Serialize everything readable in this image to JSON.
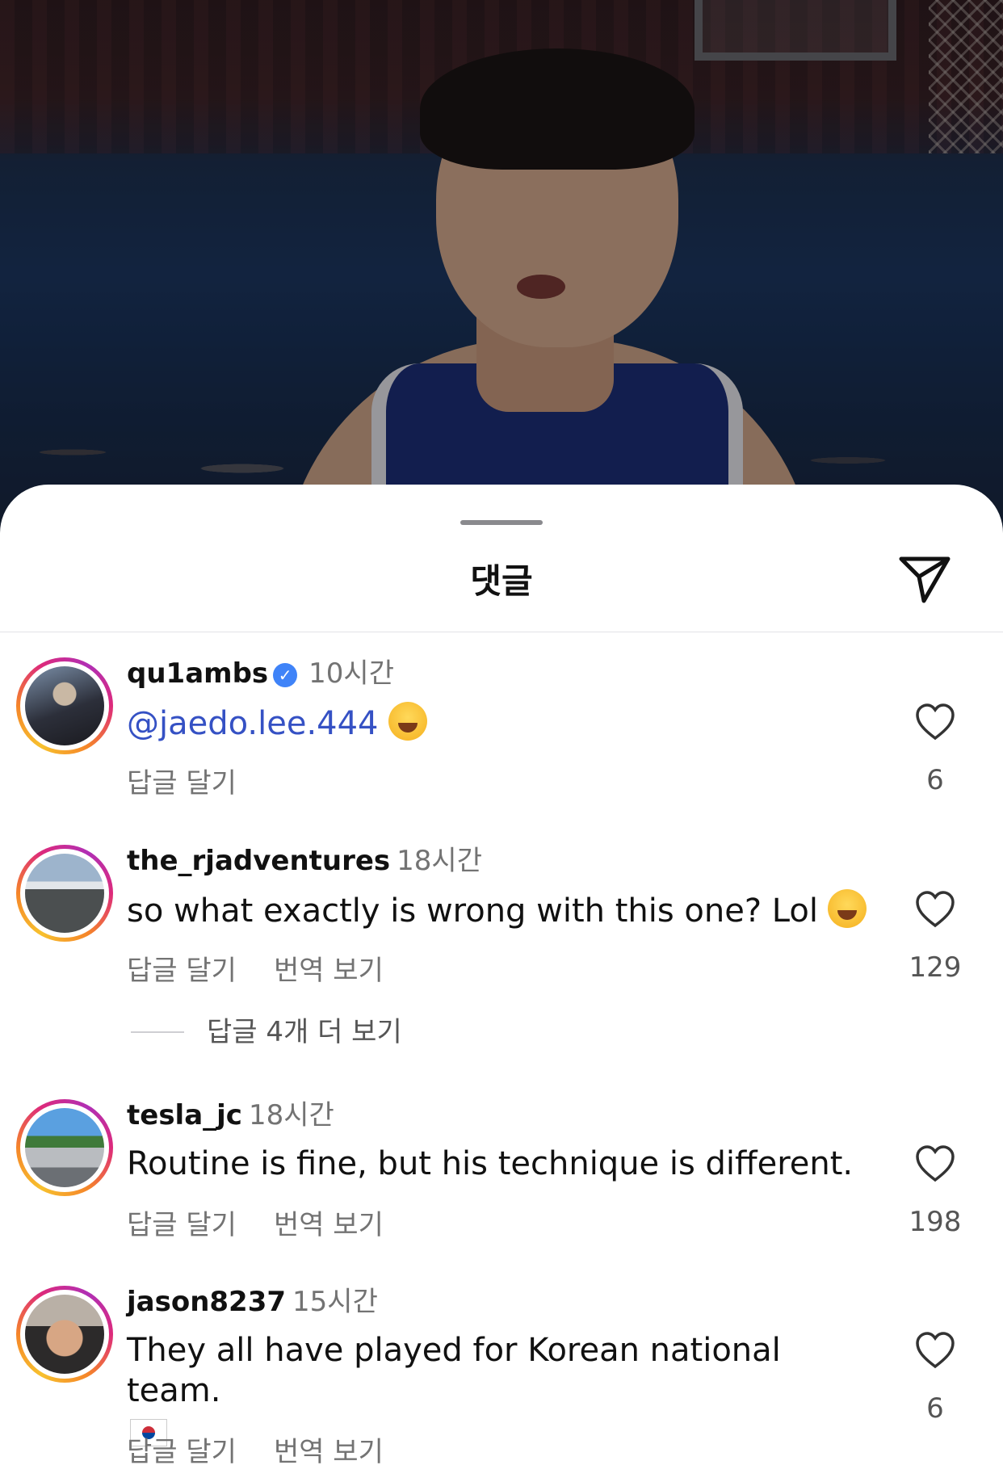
{
  "sheet": {
    "title": "댓글"
  },
  "comments": [
    {
      "username": "qu1ambs",
      "verified": true,
      "time": "10시간",
      "mention": "@jaedo.lee.444",
      "text": "",
      "emoji": "rolling-on-floor-laughing-emoji",
      "reply_label": "답글 달기",
      "translate_label": "",
      "likes": "6"
    },
    {
      "username": "the_rjadventures",
      "verified": false,
      "time": "18시간",
      "text": "so what exactly is wrong with this one? Lol",
      "emoji": "tears-of-joy-emoji",
      "reply_label": "답글 달기",
      "translate_label": "번역 보기",
      "likes": "129",
      "more_replies": "답글 4개 더 보기"
    },
    {
      "username": "tesla_jc",
      "verified": false,
      "time": "18시간",
      "text": "Routine is fine, but his technique is different.",
      "reply_label": "답글 달기",
      "translate_label": "번역 보기",
      "likes": "198"
    },
    {
      "username": "jason8237",
      "verified": false,
      "time": "15시간",
      "text": "They all have played for Korean national team.",
      "emoji": "south-korea-flag-emoji",
      "reply_label": "답글 달기",
      "translate_label": "번역 보기",
      "likes": "6"
    }
  ],
  "colors": {
    "mention": "#3551c4",
    "muted": "#737373",
    "verified": "#3f83f8"
  }
}
